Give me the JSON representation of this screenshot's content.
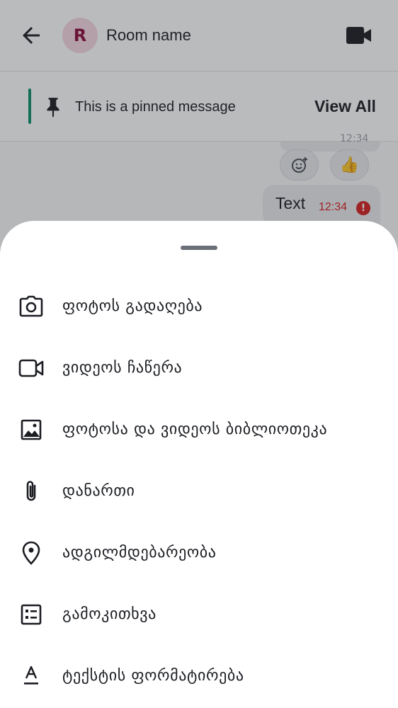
{
  "header": {
    "avatar_initial": "R",
    "room_name": "Room name"
  },
  "pinned": {
    "text": "This is a pinned message",
    "view_all_label": "View All"
  },
  "timeline": {
    "previous_time": "12:34",
    "reactions": [
      "☺",
      "👍"
    ],
    "message_text": "Text",
    "message_time": "12:34",
    "error_badge": "!"
  },
  "sheet": {
    "items": [
      {
        "label": "ფოტოს გადაღება",
        "icon": "camera-icon"
      },
      {
        "label": "ვიდეოს ჩაწერა",
        "icon": "video-camera-icon"
      },
      {
        "label": "ფოტოსა და ვიდეოს ბიბლიოთეკა",
        "icon": "image-gallery-icon"
      },
      {
        "label": "დანართი",
        "icon": "attachment-icon"
      },
      {
        "label": "ადგილმდებარეობა",
        "icon": "location-pin-icon"
      },
      {
        "label": "გამოკითხვა",
        "icon": "poll-icon"
      },
      {
        "label": "ტექსტის ფორმატირება",
        "icon": "text-formatting-icon"
      }
    ]
  },
  "colors": {
    "accent": "#0d8f6b",
    "avatar_bg": "#f6d7e0",
    "avatar_fg": "#8a0a3a",
    "error": "#d41f1f",
    "text": "#1b1d22"
  }
}
